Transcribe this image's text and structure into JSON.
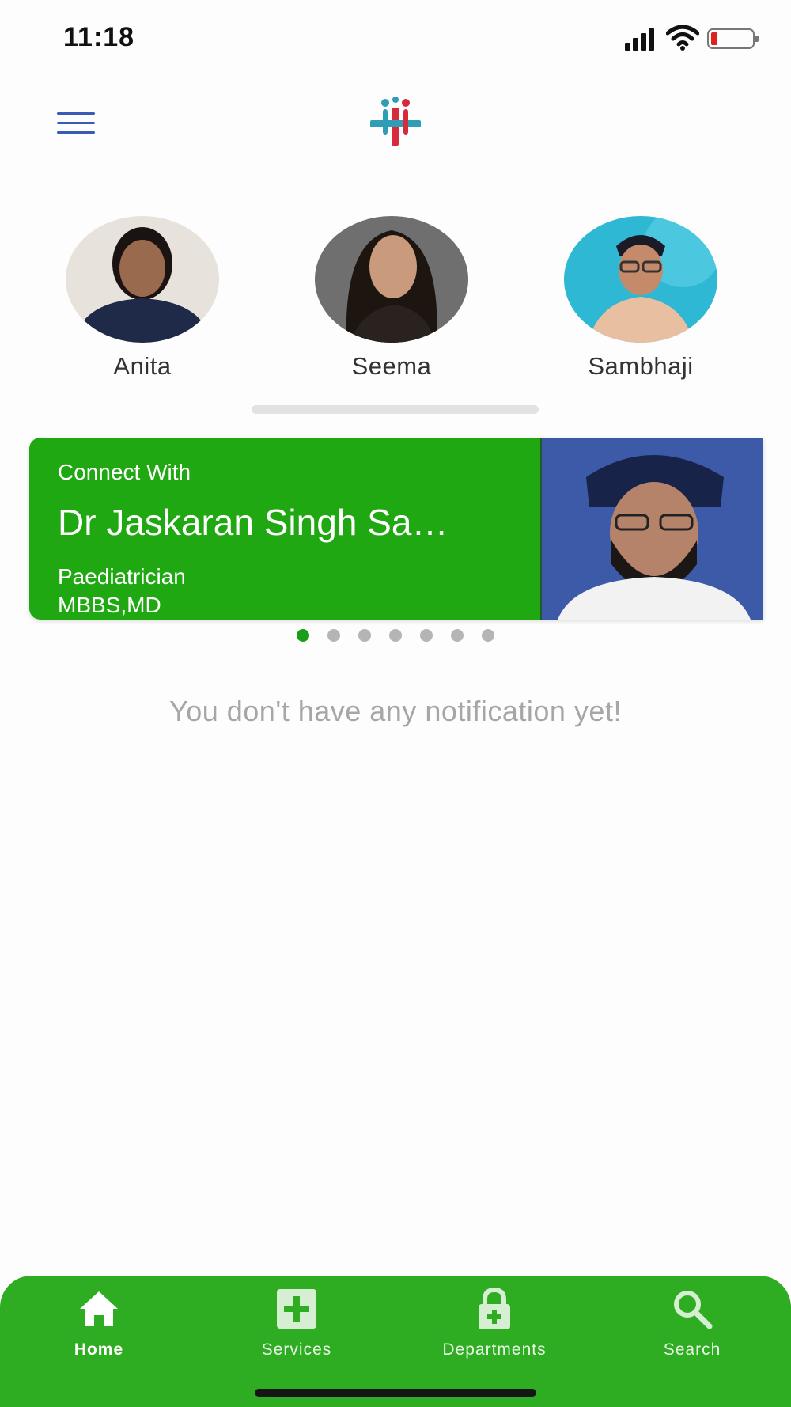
{
  "status_bar": {
    "time": "11:18",
    "battery_color": "#e02020"
  },
  "header": {
    "menu_icon": "hamburger-menu-icon",
    "logo": "family-medical-cross-logo"
  },
  "stories": [
    {
      "name": "Anita"
    },
    {
      "name": "Seema"
    },
    {
      "name": "Sambhaji"
    }
  ],
  "banner": {
    "connect_label": "Connect With",
    "doctor_name": "Dr Jaskaran Singh Sa…",
    "speciality": "Paediatrician",
    "degree": "MBBS,MD",
    "color": "#1fa812"
  },
  "carousel": {
    "total_dots": 7,
    "active_index": 0
  },
  "notifications": {
    "empty_message": "You don't have any notification yet!"
  },
  "bottom_nav": {
    "color": "#2fad22",
    "items": [
      {
        "label": "Home",
        "icon": "home-icon",
        "active": true
      },
      {
        "label": "Services",
        "icon": "medical-plus-icon",
        "active": false
      },
      {
        "label": "Departments",
        "icon": "lock-plus-icon",
        "active": false
      },
      {
        "label": "Search",
        "icon": "search-icon",
        "active": false
      }
    ]
  }
}
